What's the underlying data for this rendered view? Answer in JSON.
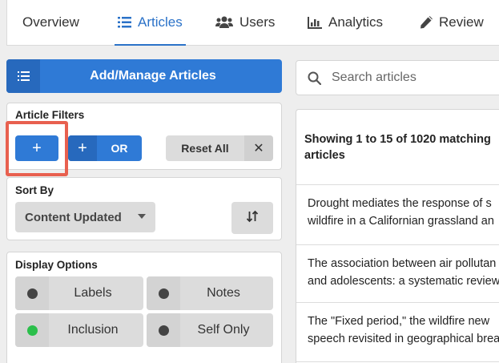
{
  "tabs": [
    {
      "label": "Overview",
      "icon": "none",
      "active": false
    },
    {
      "label": "Articles",
      "icon": "list-icon",
      "active": true
    },
    {
      "label": "Users",
      "icon": "users-icon",
      "active": false
    },
    {
      "label": "Analytics",
      "icon": "bar-chart-icon",
      "active": false
    },
    {
      "label": "Review",
      "icon": "pencil-icon",
      "active": false
    }
  ],
  "manage_button": {
    "label": "Add/Manage Articles",
    "icon": "list-icon"
  },
  "filters": {
    "title": "Article Filters",
    "add_label": "+",
    "add_or_plus": "+",
    "add_or_label": "OR",
    "reset_label": "Reset All",
    "clear_symbol": "✕"
  },
  "sort": {
    "title": "Sort By",
    "selected": "Content Updated",
    "order_icon": "sort-order-icon"
  },
  "display": {
    "title": "Display Options",
    "options": [
      {
        "label": "Labels",
        "on": false
      },
      {
        "label": "Notes",
        "on": false
      },
      {
        "label": "Inclusion",
        "on": true
      },
      {
        "label": "Self Only",
        "on": false
      }
    ]
  },
  "search": {
    "placeholder": "Search articles"
  },
  "results": {
    "summary": "Showing 1 to 15 of 1020 matching articles",
    "rows": [
      {
        "line1": "Drought mediates the response of s",
        "line2": "wildfire in a Californian grassland an"
      },
      {
        "line1": "The association between air pollutan",
        "line2": "and adolescents: a systematic review"
      },
      {
        "line1": "The \"Fixed period,\" the wildfire new",
        "line2": "speech revisited in geographical brea"
      }
    ]
  },
  "colors": {
    "accent": "#2f7ad6",
    "highlight": "#e8604f",
    "toggle_on": "#2bbf4b"
  }
}
